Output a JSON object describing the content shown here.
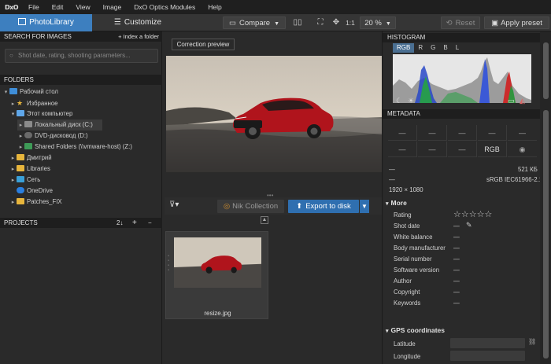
{
  "menubar": {
    "logo": "DxO",
    "items": [
      "File",
      "Edit",
      "View",
      "Image",
      "DxO Optics Modules",
      "Help"
    ]
  },
  "toolbar": {
    "tabs": [
      "PhotoLibrary",
      "Customize"
    ],
    "compare": "Compare",
    "ratio": "1:1",
    "zoom": "20 %",
    "reset": "Reset",
    "apply_preset": "Apply preset"
  },
  "search": {
    "header": "SEARCH FOR IMAGES",
    "index_folder": "+ Index a folder",
    "placeholder": "Shot date, rating, shooting parameters..."
  },
  "folders": {
    "header": "FOLDERS",
    "items": [
      {
        "label": "Рабочий стол",
        "icon": "desktop-icon"
      },
      {
        "label": "Избранное",
        "icon": "star-icon"
      },
      {
        "label": "Этот компьютер",
        "icon": "computer-icon"
      },
      {
        "label": "Локальный диск (C:)",
        "icon": "drive-icon"
      },
      {
        "label": "DVD-дисковод (D:)",
        "icon": "dvd-icon"
      },
      {
        "label": "Shared Folders (\\\\vmware-host) (Z:)",
        "icon": "network-drive-icon"
      },
      {
        "label": "Дмитрий",
        "icon": "folder-icon"
      },
      {
        "label": "Libraries",
        "icon": "folder-icon"
      },
      {
        "label": "Сеть",
        "icon": "network-icon"
      },
      {
        "label": "OneDrive",
        "icon": "onedrive-icon"
      },
      {
        "label": "Patches_FIX",
        "icon": "folder-icon"
      }
    ]
  },
  "projects": {
    "header": "PROJECTS",
    "sort": "2↓",
    "add": "+",
    "remove": "−"
  },
  "center": {
    "correction_preview": "Correction preview",
    "nik_collection": "Nik Collection",
    "export": "Export to disk",
    "thumb_name": "resize.jpg"
  },
  "histogram": {
    "header": "HISTOGRAM",
    "tabs": [
      "RGB",
      "R",
      "G",
      "B",
      "L"
    ]
  },
  "metadata": {
    "header": "METADATA",
    "grid_row1": [
      "—",
      "—",
      "—",
      "—",
      "—"
    ],
    "grid_row2": [
      "—",
      "—",
      "—",
      "RGB",
      ""
    ],
    "left1": "—",
    "size": "521 КБ",
    "left2": "—",
    "profile": "sRGB IEC61966-2.1",
    "dimensions": "1920 × 1080",
    "more": "More",
    "fields": [
      {
        "label": "Rating",
        "value": "☆☆☆☆☆"
      },
      {
        "label": "Shot date",
        "value": "—"
      },
      {
        "label": "White balance",
        "value": "—"
      },
      {
        "label": "Body manufacturer",
        "value": "—"
      },
      {
        "label": "Serial number",
        "value": "—"
      },
      {
        "label": "Software version",
        "value": "—"
      },
      {
        "label": "Author",
        "value": "—"
      },
      {
        "label": "Copyright",
        "value": "—"
      },
      {
        "label": "Keywords",
        "value": "—"
      }
    ],
    "gps_header": "GPS coordinates",
    "gps": [
      "Latitude",
      "Longitude"
    ]
  },
  "colors": {
    "accent": "#3d7fbf",
    "export": "#2f6fb0",
    "panel": "#2a2a2a",
    "car": "#b0141c"
  }
}
